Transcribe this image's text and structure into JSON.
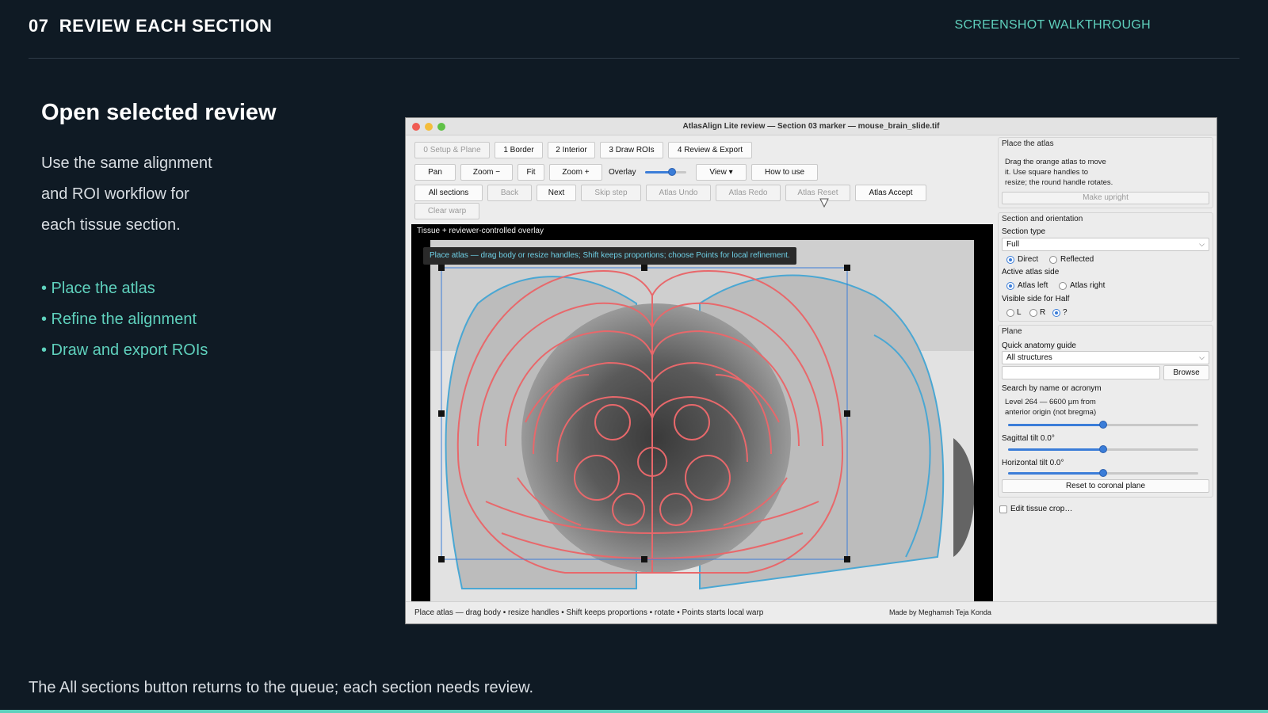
{
  "slide": {
    "number": "07",
    "heading": "REVIEW EACH SECTION",
    "label": "SCREENSHOT WALKTHROUGH",
    "title": "Open selected review",
    "desc_lines": [
      "Use the same alignment",
      "and ROI workflow for",
      "each tissue section."
    ],
    "bullets": [
      "• Place the atlas",
      "• Refine the alignment",
      "• Draw and export ROIs"
    ],
    "footer": "The All sections button returns to the queue; each section needs review."
  },
  "colors": {
    "background": "#0f1a24",
    "accent": "#5fd1bd",
    "atlas_overlay": "#e8686b",
    "tissue_outline": "#4aa7d3",
    "selection": "#3b7dd8"
  },
  "app": {
    "window_title": "AtlasAlign Lite review — Section 03 marker — mouse_brain_slide.tif",
    "steps": [
      "0 Setup & Plane",
      "1 Border",
      "2 Interior",
      "3 Draw ROIs",
      "4 Review & Export"
    ],
    "toolbar": {
      "pan": "Pan",
      "zoom_out": "Zoom −",
      "fit": "Fit",
      "zoom_in": "Zoom +",
      "overlay": "Overlay",
      "overlay_level": 0.66,
      "view": "View ▾",
      "how_to_use": "How to use"
    },
    "nav": {
      "all_sections": "All sections",
      "back": "Back",
      "next": "Next",
      "skip_step": "Skip step",
      "atlas_undo": "Atlas Undo",
      "atlas_redo": "Atlas Redo",
      "atlas_reset": "Atlas Reset",
      "atlas_accept": "Atlas Accept",
      "clear_warp": "Clear warp"
    },
    "viewer": {
      "label": "Tissue + reviewer-controlled overlay",
      "banner": "Place atlas — drag body or resize handles; Shift keeps proportions; choose Points for local refinement."
    },
    "status": {
      "left": "Place atlas — drag body • resize handles • Shift keeps proportions • rotate • Points starts local warp",
      "right": "Made by Meghamsh Teja Konda"
    },
    "sidebar": {
      "place": {
        "title": "Place the atlas",
        "help": [
          "Drag the orange atlas to move",
          "it. Use square handles to",
          "resize; the round handle rotates."
        ],
        "make_upright": "Make upright"
      },
      "orientation": {
        "title": "Section and orientation",
        "section_type_label": "Section type",
        "section_type_value": "Full",
        "direct": "Direct",
        "reflected": "Reflected",
        "atlas_side_label": "Active atlas side",
        "atlas_left": "Atlas left",
        "atlas_right": "Atlas right",
        "visible_side_label": "Visible side for Half",
        "l": "L",
        "r": "R",
        "q": "?"
      },
      "plane": {
        "title": "Plane",
        "guide_label": "Quick anatomy guide",
        "guide_value": "All structures",
        "browse": "Browse",
        "search_label": "Search by name or acronym",
        "level_text": [
          "Level 264 — 6600 µm from",
          "anterior origin (not bregma)"
        ],
        "level_position": 0.5,
        "sagittal": "Sagittal tilt 0.0°",
        "sagittal_position": 0.5,
        "horizontal": "Horizontal tilt 0.0°",
        "horizontal_position": 0.5,
        "reset": "Reset to coronal plane"
      },
      "edit_crop": "Edit tissue crop…"
    }
  }
}
